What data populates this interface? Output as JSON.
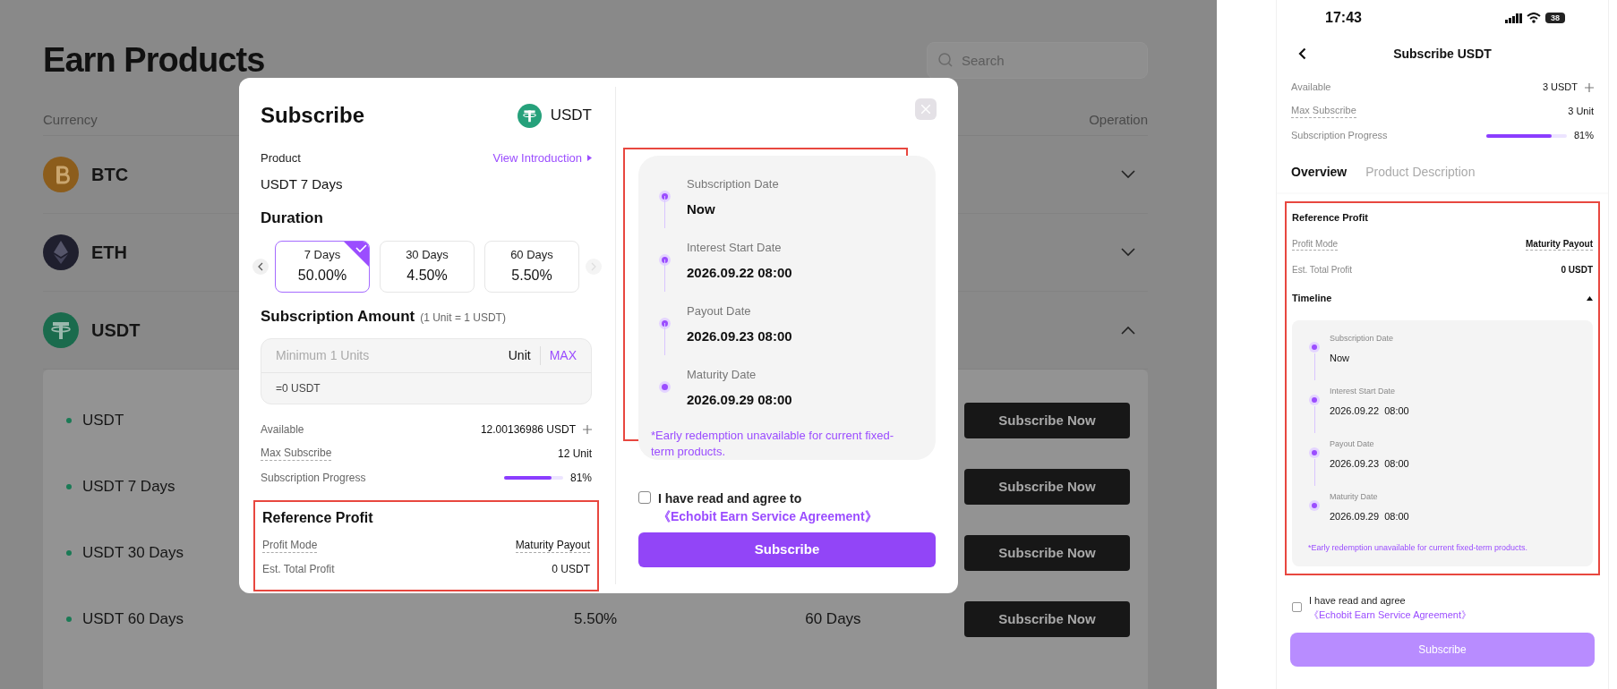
{
  "page": {
    "title": "Earn Products",
    "search": {
      "placeholder": "Search"
    },
    "columns": [
      "Currency",
      "Operation"
    ],
    "currencies": [
      {
        "name": "BTC",
        "expanded": false
      },
      {
        "name": "ETH",
        "expanded": false
      },
      {
        "name": "USDT",
        "expanded": true
      }
    ],
    "products": [
      {
        "name": "USDT",
        "button": "Subscribe Now"
      },
      {
        "name": "USDT 7 Days",
        "button": "Subscribe Now"
      },
      {
        "name": "USDT 30 Days",
        "button": "Subscribe Now"
      },
      {
        "name": "USDT 60 Days",
        "rate": "5.50%",
        "duration": "60 Days",
        "button": "Subscribe Now"
      }
    ]
  },
  "subscribe_dialog": {
    "title": "Subscribe",
    "currency": "USDT",
    "product_label": "Product",
    "product": "USDT 7 Days",
    "view_introduction": "View Introduction",
    "duration_heading": "Duration",
    "durations": [
      {
        "days": "7 Days",
        "rate": "50.00%",
        "selected": true
      },
      {
        "days": "30 Days",
        "rate": "4.50%",
        "selected": false
      },
      {
        "days": "60 Days",
        "rate": "5.50%",
        "selected": false
      }
    ],
    "amount_heading": "Subscription Amount",
    "amount_note": "(1 Unit = 1 USDT)",
    "amount_placeholder": "Minimum 1 Units",
    "unit": "Unit",
    "max": "MAX",
    "converted": "=0 USDT",
    "stats": [
      {
        "label": "Available",
        "value": "12.00136986 USDT",
        "kind": "plus"
      },
      {
        "label": "Max Subscribe",
        "value": "12 Unit",
        "kind": "dotted"
      },
      {
        "label": "Subscription Progress",
        "value": "81%",
        "kind": "progress",
        "level": 0.81
      }
    ],
    "reference_heading": "Reference Profit",
    "profit": [
      {
        "label": "Profit Mode",
        "value": "Maturity Payout",
        "kind": "dotted"
      },
      {
        "label": "Est. Total Profit",
        "value": "0 USDT",
        "kind": "plain"
      }
    ],
    "timeline": [
      {
        "label": "Subscription Date",
        "value": "Now"
      },
      {
        "label": "Interest Start Date",
        "value": "2026.09.22 08:00"
      },
      {
        "label": "Payout Date",
        "value": "2026.09.23 08:00"
      },
      {
        "label": "Maturity Date",
        "value": "2026.09.29 08:00"
      }
    ],
    "note": "*Early redemption unavailable for current fixed-term products.",
    "agree_text": "I have read and agree to",
    "agree_link": "《Echobit Earn Service Agreement》",
    "agree_checked": false,
    "button": "Subscribe",
    "button_disabled": false
  },
  "mobile": {
    "time": "17:43",
    "battery": "38",
    "title": "Subscribe USDT",
    "stats": [
      {
        "label": "Available",
        "value": "3 USDT",
        "kind": "plus"
      },
      {
        "label": "Max Subscribe",
        "value": "3 Unit",
        "kind": "dotted"
      },
      {
        "label": "Subscription Progress",
        "value": "81%",
        "kind": "progress",
        "level": 0.81
      }
    ],
    "tabs": [
      {
        "label": "Overview",
        "selected": true
      },
      {
        "label": "Product Description",
        "selected": false
      }
    ],
    "reference_heading": "Reference Profit",
    "profit": [
      {
        "label": "Profit Mode",
        "value": "Maturity Payout",
        "kind": "dotted"
      },
      {
        "label": "Est. Total Profit",
        "value": "0 USDT",
        "kind": "plain"
      }
    ],
    "timeline_heading": "Timeline",
    "timeline_expanded": true,
    "timeline": [
      {
        "label": "Subscription Date",
        "value": "Now"
      },
      {
        "label": "Interest Start Date",
        "value": "2026.09.22  08:00"
      },
      {
        "label": "Payout Date",
        "value": "2026.09.23  08:00"
      },
      {
        "label": "Maturity Date",
        "value": "2026.09.29  08:00"
      }
    ],
    "note": "*Early redemption unavailable for current fixed-term products.",
    "agree_text": "I have read and agree",
    "agree_link": "《Echobit Earn Service Agreement》",
    "agree_checked": false,
    "button": "Subscribe",
    "button_disabled": true
  }
}
